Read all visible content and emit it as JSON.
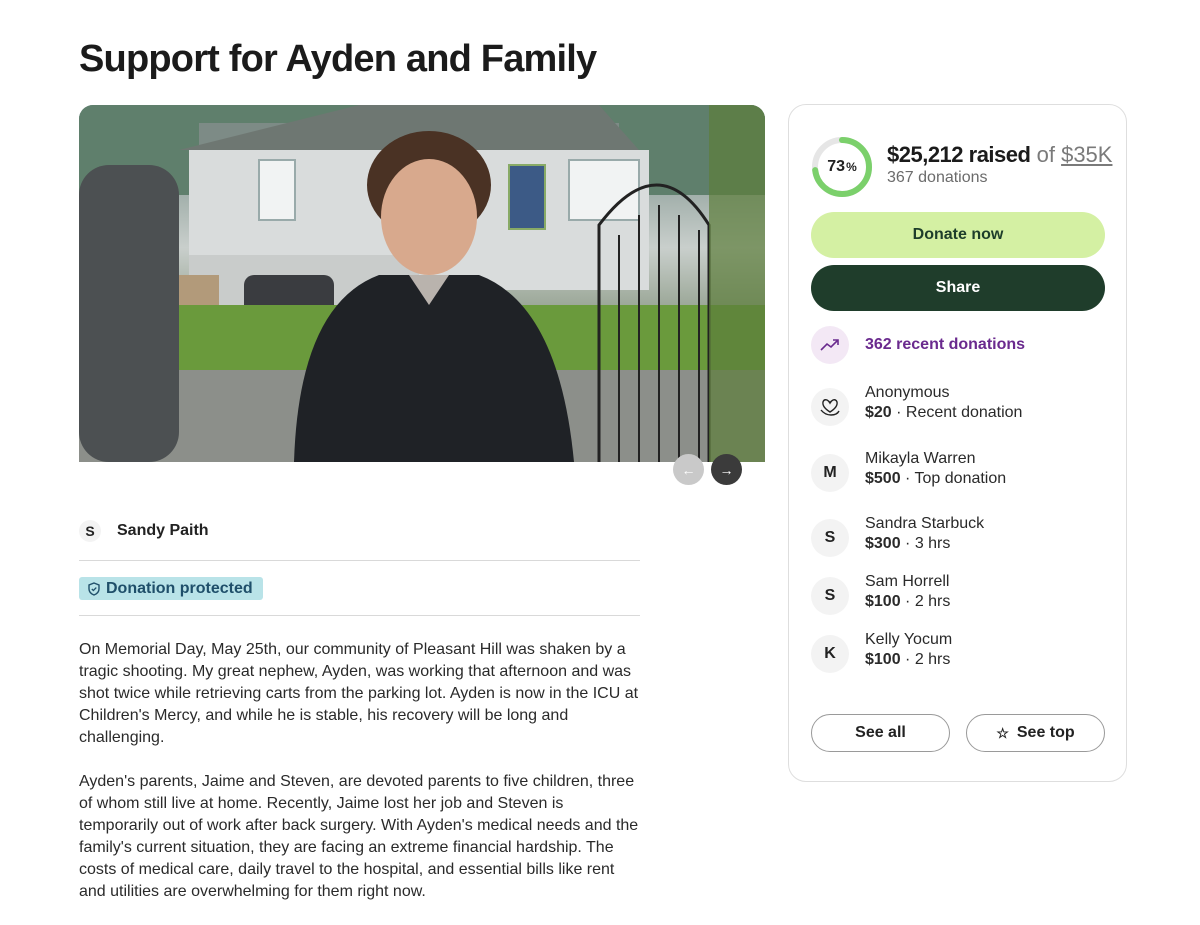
{
  "page": {
    "title": "Support for Ayden and Family"
  },
  "carousel": {
    "prev_icon": "arrow-left-icon",
    "next_icon": "arrow-right-icon"
  },
  "organizer": {
    "initial": "S",
    "name": "Sandy Paith"
  },
  "badge": {
    "label": "Donation protected",
    "icon": "shield-icon"
  },
  "story": {
    "paragraphs": [
      "On Memorial Day, May 25th, our community of Pleasant Hill was shaken by a tragic shooting. My great nephew, Ayden, was working that afternoon and was shot twice while retrieving carts from the parking lot. Ayden is now in the ICU at Children's Mercy, and while he is stable, his recovery will be long and challenging.",
      "Ayden's parents, Jaime and Steven, are devoted parents to five children, three of whom still live at home. Recently, Jaime lost her job and Steven is temporarily out of work after back surgery. With Ayden's medical needs and the family's current situation, they are facing an extreme financial hardship. The costs of medical care, daily travel to the hospital, and essential bills like rent and utilities are overwhelming for them right now."
    ]
  },
  "fundraiser": {
    "percent": 73,
    "percent_label": "73",
    "percent_sign": "%",
    "raised": "$25,212 raised",
    "of": "of",
    "goal": "$35K",
    "donation_count": "367 donations",
    "ring_color": "#7bd06b",
    "ring_track_color": "#e6e6e6"
  },
  "actions": {
    "donate_label": "Donate now",
    "share_label": "Share"
  },
  "recent": {
    "label": "362 recent donations",
    "icon": "trending-up-icon",
    "donors": [
      {
        "initial": "",
        "icon": "heart-hand-icon",
        "name": "Anonymous",
        "amount": "$20",
        "note": " · Recent donation"
      },
      {
        "initial": "M",
        "name": "Mikayla Warren",
        "amount": "$500",
        "note": " · Top donation"
      },
      {
        "initial": "S",
        "name": "Sandra Starbuck",
        "amount": "$300",
        "note": " · 3 hrs"
      },
      {
        "initial": "S",
        "name": "Sam Horrell",
        "amount": "$100",
        "note": " · 2 hrs"
      },
      {
        "initial": "K",
        "name": "Kelly Yocum",
        "amount": "$100",
        "note": " · 2 hrs"
      }
    ],
    "see_all_label": "See all",
    "see_top_label": "See top",
    "see_top_icon": "star-icon"
  }
}
